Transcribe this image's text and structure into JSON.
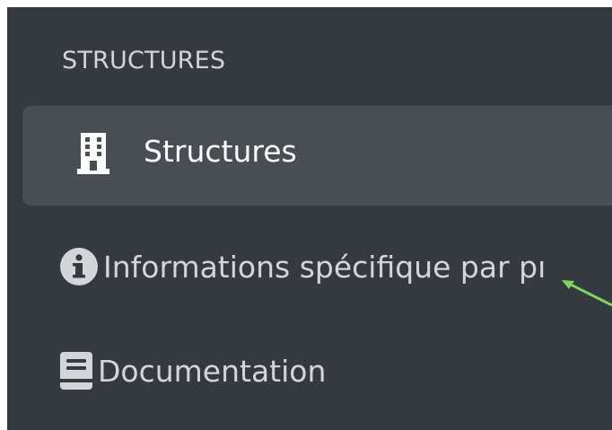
{
  "sidebar": {
    "section_header": "STRUCTURES",
    "items": [
      {
        "label": "Structures",
        "icon": "building-icon",
        "active": true
      },
      {
        "label": "Informations spécifique par pı",
        "icon": "info-circle-icon",
        "active": false
      },
      {
        "label": "Documentation",
        "icon": "book-icon",
        "active": false
      }
    ]
  },
  "colors": {
    "sidebar_bg": "#343a40",
    "active_bg": "#494e55",
    "text": "#d3d6d9",
    "active_text": "#ffffff",
    "annotation_arrow": "#7ed957"
  }
}
